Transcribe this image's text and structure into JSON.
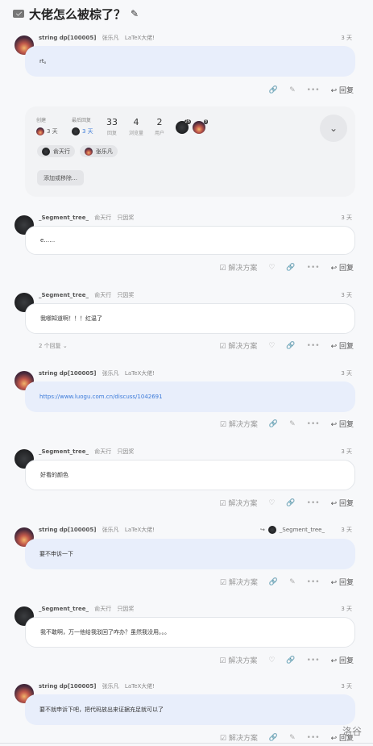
{
  "topic": {
    "title": "大佬怎么被棕了？",
    "title_icon": "mail-icon",
    "edit_icon": "pencil-icon"
  },
  "labels": {
    "reply": "回复",
    "solve": "解决方案"
  },
  "summary": {
    "created_label": "创建",
    "created_time": "3 天",
    "last_reply_label": "最后回复",
    "last_reply_time": "3 天",
    "replies_value": "33",
    "replies_label": "回复",
    "views_value": "4",
    "views_label": "浏览量",
    "users_value": "2",
    "users_label": "用户",
    "badge_1": "26",
    "badge_2": "8",
    "participants": [
      "俞天行",
      "张乐凡"
    ],
    "add_remove": "添加或移除…"
  },
  "posts": [
    {
      "user": "string dp[100005]",
      "name": "张乐凡",
      "tag": "LaTeX大佬!",
      "time": "3 天",
      "content": "rt。"
    },
    {
      "user": "_Segment_tree_",
      "name": "俞天行",
      "tag": "只因奖",
      "time": "3 天",
      "content": "e……"
    },
    {
      "user": "_Segment_tree_",
      "name": "俞天行",
      "tag": "只因奖",
      "time": "3 天",
      "content": "我哪知道啊！！！红温了",
      "replies": "2 个回复"
    },
    {
      "user": "string dp[100005]",
      "name": "张乐凡",
      "tag": "LaTeX大佬!",
      "time": "3 天",
      "content": "https://www.luogu.com.cn/discuss/1042691"
    },
    {
      "user": "_Segment_tree_",
      "name": "俞天行",
      "tag": "只因奖",
      "time": "3 天",
      "content": "好看的颜色"
    },
    {
      "user": "string dp[100005]",
      "name": "张乐凡",
      "tag": "LaTeX大佬!",
      "time": "3 天",
      "content": "要不申诉一下",
      "reply_to": "_Segment_tree_"
    },
    {
      "user": "_Segment_tree_",
      "name": "俞天行",
      "tag": "只因奖",
      "time": "3 天",
      "content": "我不敢啊，万一他给我驳回了咋办？虽然我没用。。。"
    },
    {
      "user": "string dp[100005]",
      "name": "张乐凡",
      "tag": "LaTeX大佬!",
      "time": "3 天",
      "content": "要不就申诉下吧，把代码放出来证据充足就可以了"
    }
  ],
  "watermark": "洛谷"
}
